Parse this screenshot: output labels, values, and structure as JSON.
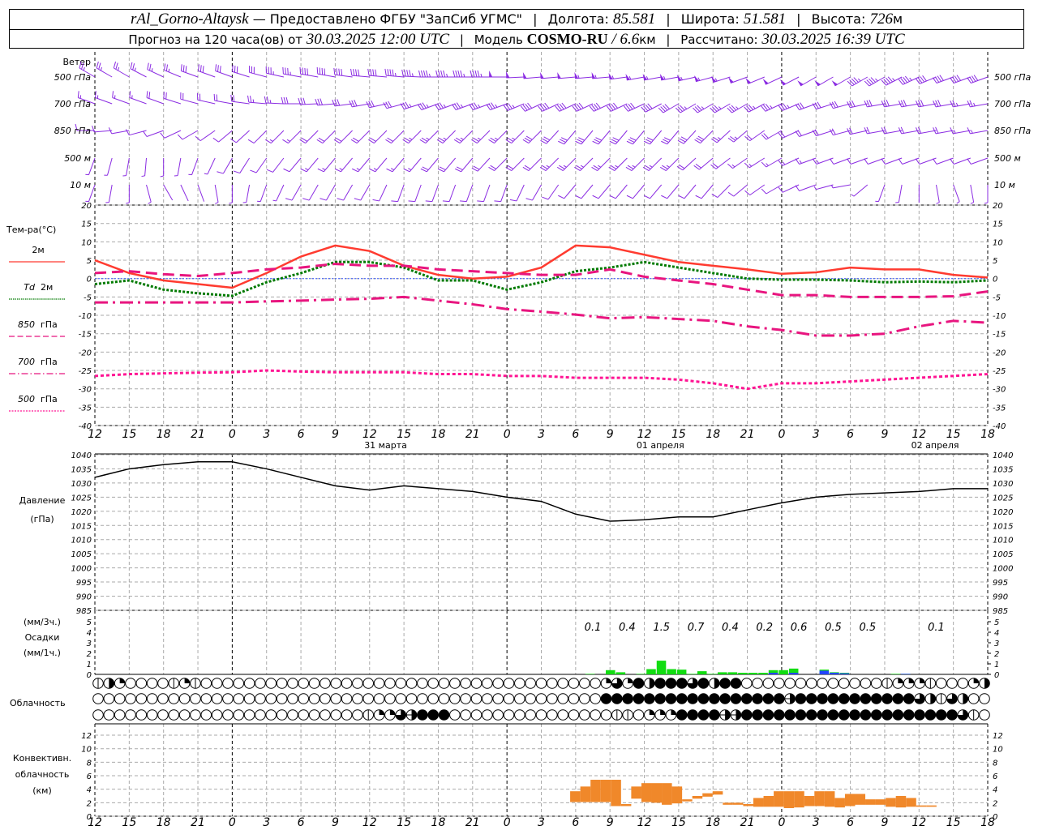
{
  "header": {
    "station": "rAl_Gorno-Altaysk",
    "provider": "— Предоставлено ФГБУ \"ЗапСиб УГМС\"",
    "sep": "|",
    "lon_label": "Долгота:",
    "lon": "85.581",
    "lat_label": "Широта:",
    "lat": "51.581",
    "alt_label": "Высота:",
    "alt": "726",
    "alt_unit": "м",
    "forecast_label": "Прогноз на 120 часа(ов) от",
    "forecast_time": "30.03.2025 12:00 UTC",
    "model_label": "Модель",
    "model": "COSMO-RU",
    "model_sep": "/",
    "resolution": "6.6",
    "res_unit": "км",
    "calc_label": "Рассчитано:",
    "calc_time": "30.03.2025 16:39 UTC"
  },
  "colors": {
    "wind": "#8a2be2",
    "t2m": "#ff3b30",
    "td2m": "#007a00",
    "t850": "#e8157f",
    "t700": "#e8157f",
    "t500": "#ff1493",
    "zero_line": "#3355ff",
    "pressure": "#000000",
    "precip_rain": "#11dd11",
    "precip_snow": "#2244ff",
    "convective": "#f0882a",
    "grid": "#aaaaaa"
  },
  "chart_data": [
    {
      "type": "barbs",
      "title": "Ветер",
      "x": [
        "12",
        "15",
        "18",
        "21",
        "0",
        "3",
        "6",
        "9",
        "12",
        "15",
        "18",
        "21",
        "0",
        "3",
        "6",
        "9",
        "12",
        "15",
        "18",
        "21",
        "0",
        "3",
        "6",
        "9",
        "12",
        "15",
        "18"
      ],
      "levels": [
        {
          "label": "500 гПа",
          "dir": [
            300,
            300,
            295,
            290,
            290,
            285,
            280,
            280,
            275,
            275,
            270,
            270,
            270,
            265,
            265,
            265,
            260,
            260,
            255,
            250,
            245,
            240,
            240,
            240,
            245,
            250,
            250
          ],
          "speed": [
            12,
            12,
            13,
            14,
            15,
            16,
            18,
            20,
            20,
            22,
            22,
            23,
            24,
            25,
            26,
            27,
            28,
            28,
            27,
            26,
            25,
            25,
            24,
            23,
            22,
            20,
            20
          ]
        },
        {
          "label": "700 гПа",
          "dir": [
            290,
            290,
            290,
            285,
            280,
            275,
            270,
            265,
            260,
            255,
            250,
            250,
            250,
            245,
            245,
            245,
            245,
            240,
            240,
            240,
            245,
            250,
            255,
            260,
            260,
            260,
            260
          ],
          "speed": [
            8,
            8,
            9,
            9,
            10,
            12,
            14,
            15,
            16,
            16,
            17,
            18,
            18,
            19,
            20,
            20,
            20,
            19,
            18,
            18,
            17,
            16,
            15,
            15,
            14,
            14,
            13
          ]
        },
        {
          "label": "850 гПа",
          "dir": [
            270,
            260,
            250,
            240,
            230,
            225,
            225,
            225,
            225,
            225,
            225,
            225,
            225,
            225,
            220,
            220,
            220,
            220,
            225,
            230,
            240,
            250,
            255,
            260,
            260,
            260,
            260
          ],
          "speed": [
            4,
            5,
            5,
            4,
            4,
            6,
            8,
            10,
            10,
            11,
            12,
            12,
            13,
            14,
            15,
            16,
            16,
            15,
            14,
            12,
            10,
            10,
            10,
            10,
            9,
            9,
            8
          ]
        },
        {
          "label": "500 м",
          "dir": [
            200,
            190,
            180,
            200,
            210,
            215,
            220,
            220,
            220,
            220,
            220,
            220,
            225,
            225,
            225,
            225,
            225,
            225,
            230,
            235,
            240,
            250,
            250,
            250,
            250,
            250,
            250
          ],
          "speed": [
            2,
            2,
            3,
            3,
            4,
            5,
            6,
            7,
            8,
            8,
            9,
            9,
            10,
            11,
            12,
            13,
            12,
            12,
            10,
            8,
            7,
            7,
            6,
            6,
            5,
            5,
            5
          ]
        },
        {
          "label": "10 м",
          "dir": [
            200,
            180,
            150,
            160,
            180,
            200,
            210,
            210,
            210,
            200,
            200,
            200,
            200,
            210,
            220,
            220,
            220,
            220,
            220,
            230,
            240,
            250,
            260,
            200,
            180,
            160,
            180
          ],
          "speed": [
            2,
            2,
            1,
            1,
            2,
            3,
            4,
            4,
            5,
            4,
            4,
            4,
            5,
            5,
            6,
            6,
            6,
            5,
            4,
            4,
            4,
            4,
            3,
            2,
            1,
            2,
            3
          ]
        }
      ]
    },
    {
      "type": "line",
      "title": "Тем-ра(°C)",
      "x": [
        "12",
        "15",
        "18",
        "21",
        "0",
        "3",
        "6",
        "9",
        "12",
        "15",
        "18",
        "21",
        "0",
        "3",
        "6",
        "9",
        "12",
        "15",
        "18",
        "21",
        "0",
        "3",
        "6",
        "9",
        "12",
        "15",
        "18"
      ],
      "ylim": [
        -40,
        20
      ],
      "yticks": [
        "20",
        "15",
        "10",
        "5",
        "0",
        "-5",
        "-10",
        "-15",
        "-20",
        "-25",
        "-30",
        "-35",
        "-40"
      ],
      "grid": true,
      "series": [
        {
          "name": "2м",
          "prefix": "",
          "values": [
            5,
            1.5,
            -0.5,
            -1.5,
            -2.5,
            1.5,
            6,
            9,
            7.5,
            3.5,
            1,
            0,
            0.5,
            3,
            9,
            8.5,
            6.5,
            4.5,
            3.5,
            2.5,
            1.3,
            1.7,
            3,
            2.5,
            2.5,
            1,
            0.3
          ]
        },
        {
          "name": "2м",
          "prefix": "Td",
          "values": [
            -1.5,
            -0.5,
            -3,
            -4,
            -4.7,
            -1,
            1.5,
            4.5,
            4.5,
            3,
            -0.5,
            -0.5,
            -3,
            -1,
            2,
            3,
            4.5,
            3,
            1.5,
            0,
            -0.3,
            -0.3,
            -0.5,
            -1,
            -0.8,
            -1,
            -0.5
          ]
        },
        {
          "name": "гПа",
          "prefix": "850",
          "values": [
            1.5,
            2,
            1.2,
            0.7,
            1.5,
            2.5,
            3,
            4,
            3.5,
            3.5,
            2.5,
            2,
            1.5,
            1,
            1,
            2.5,
            0.5,
            -0.5,
            -1.5,
            -3,
            -4.5,
            -4.5,
            -5,
            -5,
            -5,
            -4.8,
            -3.5
          ]
        },
        {
          "name": "гПа",
          "prefix": "700",
          "values": [
            -6.5,
            -6.5,
            -6.5,
            -6.5,
            -6.5,
            -6.2,
            -6,
            -5.7,
            -5.5,
            -5,
            -6,
            -7,
            -8.3,
            -9,
            -9.8,
            -10.8,
            -10.5,
            -11,
            -11.5,
            -13,
            -14,
            -15.5,
            -15.5,
            -15,
            -13,
            -11.5,
            -12
          ]
        },
        {
          "name": "гПа",
          "prefix": "500",
          "values": [
            -26.5,
            -26,
            -25.8,
            -25.6,
            -25.5,
            -25,
            -25.3,
            -25.5,
            -25.5,
            -25.5,
            -26,
            -26,
            -26.5,
            -26.5,
            -27,
            -27,
            -27,
            -27.5,
            -28.5,
            -30,
            -28.5,
            -28.5,
            -28,
            -27.5,
            -27,
            -26.5,
            -26
          ]
        }
      ],
      "time_labels": [
        "12",
        "15",
        "18",
        "21",
        "0",
        "3",
        "6",
        "9",
        "12",
        "15",
        "18",
        "21",
        "0",
        "3",
        "6",
        "9",
        "12",
        "15",
        "18",
        "21",
        "0",
        "3",
        "6",
        "9",
        "12",
        "15",
        "18"
      ],
      "date_labels": [
        "31 марта",
        "01 апреля",
        "02 апреля"
      ]
    },
    {
      "type": "line",
      "title": "Давление",
      "unit": "(гПа)",
      "ylim": [
        985,
        1040
      ],
      "yticks": [
        "1040",
        "1035",
        "1030",
        "1025",
        "1020",
        "1015",
        "1010",
        "1005",
        "1000",
        "995",
        "990",
        "985"
      ],
      "grid": true,
      "values": [
        1032,
        1035,
        1036.5,
        1037.5,
        1037.5,
        1035,
        1032,
        1029,
        1027.5,
        1029,
        1028,
        1027,
        1025,
        1023.5,
        1019,
        1016.5,
        1017,
        1018,
        1018,
        1020.5,
        1023,
        1025,
        1026,
        1026.5,
        1027,
        1028,
        1028
      ]
    },
    {
      "type": "bar",
      "title": "Осадки",
      "unit_3h": "(мм/3ч.)",
      "unit_1h": "(мм/1ч.)",
      "ylim": [
        0,
        5
      ],
      "yticks": [
        "5",
        "4",
        "3",
        "2",
        "1",
        "0"
      ],
      "totals_3h": [
        "0.1",
        "0.4",
        "1.5",
        "0.7",
        "0.4",
        "0.2",
        "0.6",
        "0.5",
        "0.5",
        "",
        "0.1"
      ],
      "hourly_total": [
        0.05,
        0,
        0.4,
        0.2,
        0,
        0.05,
        0.5,
        1.3,
        0.5,
        0.45,
        0.05,
        0.3,
        0.05,
        0.2,
        0.2,
        0.15,
        0.15,
        0.15,
        0.4,
        0.4,
        0.55,
        0,
        0,
        0.45,
        0.2,
        0.15,
        0,
        0,
        0,
        0,
        0.05,
        0.05
      ],
      "hourly_snow": [
        0,
        0,
        0,
        0,
        0,
        0,
        0,
        0,
        0,
        0,
        0,
        0,
        0,
        0,
        0,
        0,
        0,
        0,
        0.15,
        0,
        0.15,
        0,
        0,
        0.35,
        0.15,
        0.1,
        0,
        0,
        0,
        0,
        0,
        0.05
      ]
    },
    {
      "type": "table",
      "title": "Облачность",
      "legend": "0 clear, 1 trace, 2 quarter, 4 half, 6 three-quarters, 8 overcast, 9 half obscured",
      "rows": [
        "14200001210000000000000000000000000000000000000262848886848800000000000001222100024",
        "00000000000000000000000000000000000000000000000888888888888888889888888888886416400",
        "00000000000000000000000001226988800000000000000011022288889988888888888888888888610"
      ]
    },
    {
      "type": "bar",
      "title": "Конвективн.",
      "subtitle": "облачность",
      "unit": "(км)",
      "ylim": [
        0,
        13
      ],
      "yticks": [
        "12",
        "10",
        "8",
        "6",
        "4",
        "2",
        "0"
      ],
      "layers": [
        [
          2.1,
          3.7
        ],
        [
          2.1,
          4.4
        ],
        [
          2.1,
          5.4
        ],
        [
          2.1,
          5.4
        ],
        [
          1.5,
          5.4
        ],
        [
          1.5,
          1.8
        ],
        [
          2.6,
          4.4
        ],
        [
          2.1,
          4.9
        ],
        [
          2.0,
          4.9
        ],
        [
          1.7,
          4.9
        ],
        [
          1.9,
          4.4
        ],
        [
          2.2,
          2.5
        ],
        [
          2.6,
          3.0
        ],
        [
          2.9,
          3.4
        ],
        [
          3.2,
          3.7
        ],
        [
          1.7,
          2.0
        ],
        [
          1.7,
          2.0
        ],
        [
          1.5,
          1.8
        ],
        [
          1.4,
          2.7
        ],
        [
          1.4,
          3.0
        ],
        [
          1.4,
          3.7
        ],
        [
          1.2,
          3.7
        ],
        [
          1.3,
          3.7
        ],
        [
          1.5,
          3.0
        ],
        [
          1.5,
          3.7
        ],
        [
          1.4,
          3.7
        ],
        [
          1.3,
          2.7
        ],
        [
          1.5,
          3.3
        ],
        [
          1.7,
          3.3
        ],
        [
          1.7,
          2.5
        ],
        [
          1.7,
          2.5
        ],
        [
          1.4,
          2.7
        ],
        [
          1.3,
          3.0
        ],
        [
          1.4,
          2.7
        ],
        [
          1.4,
          1.6
        ],
        [
          1.4,
          1.6
        ]
      ]
    }
  ]
}
